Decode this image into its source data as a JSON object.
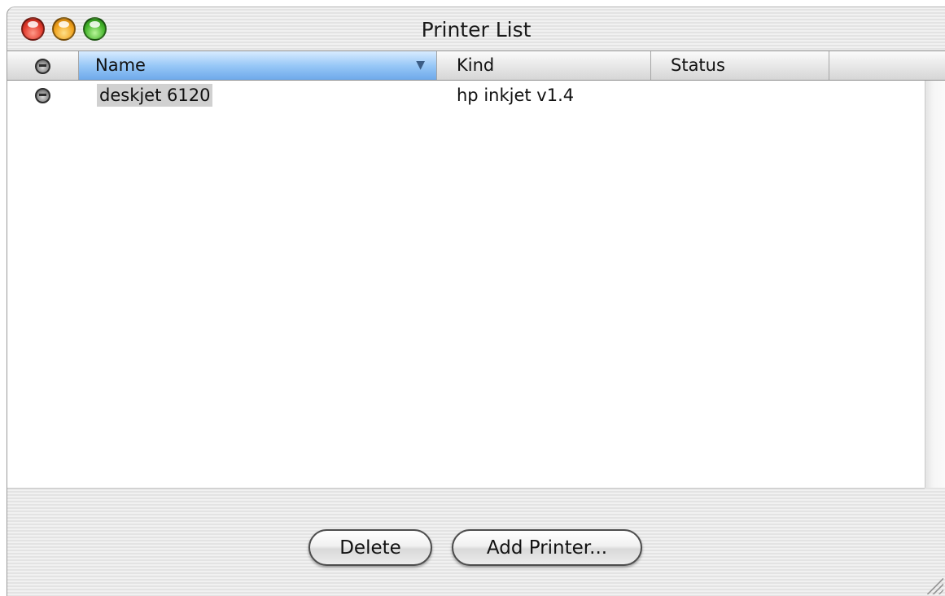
{
  "window": {
    "title": "Printer List"
  },
  "columns": {
    "icon_header": "printer-status-icon",
    "name": "Name",
    "kind": "Kind",
    "status": "Status",
    "sort_indicator": "▼"
  },
  "printers": [
    {
      "name": "deskjet 6120",
      "kind": "hp inkjet v1.4",
      "status": "",
      "icon": "printer-status-icon",
      "selected": true
    }
  ],
  "buttons": {
    "delete": "Delete",
    "add_printer": "Add Printer..."
  },
  "colors": {
    "close": "#e23a2c",
    "minimize": "#f0a21c",
    "zoom": "#46b62c",
    "sorted_column": "#98c8f7",
    "selection_highlight": "#d0d0d0"
  }
}
